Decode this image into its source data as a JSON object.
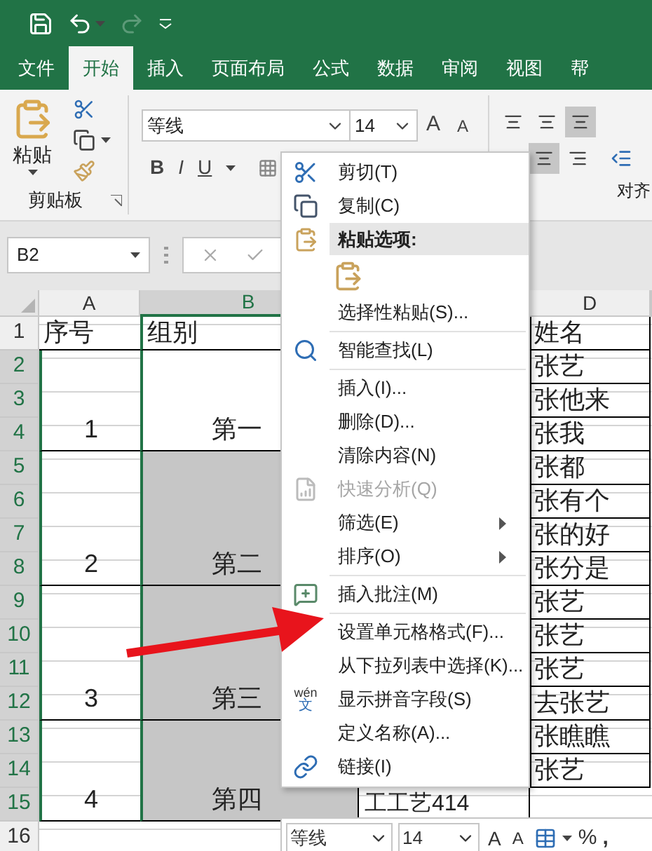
{
  "tabs": [
    {
      "label": "文件",
      "selected": false
    },
    {
      "label": "开始",
      "selected": true
    },
    {
      "label": "插入",
      "selected": false
    },
    {
      "label": "页面布局",
      "selected": false
    },
    {
      "label": "公式",
      "selected": false
    },
    {
      "label": "数据",
      "selected": false
    },
    {
      "label": "审阅",
      "selected": false
    },
    {
      "label": "视图",
      "selected": false
    },
    {
      "label": "帮",
      "selected": false
    }
  ],
  "ribbon": {
    "paste_label": "粘贴",
    "clipboard_group": "剪贴板",
    "font_name": "等线",
    "font_size": "14",
    "grow_font": "A",
    "shrink_font": "A",
    "bold": "B",
    "italic": "I",
    "underline": "U",
    "align_group": "对齐",
    "align_buttons": [
      {
        "selected": false
      },
      {
        "selected": false
      },
      {
        "selected": true
      }
    ],
    "halign_buttons": [
      {
        "selected": true
      },
      {
        "selected": false
      }
    ]
  },
  "formula_bar": {
    "name_box": "B2"
  },
  "sheet": {
    "column_headers": [
      {
        "label": "A",
        "selected": false
      },
      {
        "label": "B",
        "selected": true
      },
      {
        "label": "D",
        "selected": false
      }
    ],
    "row_headers": [
      {
        "label": "1",
        "selected": false
      },
      {
        "label": "2",
        "selected": true
      },
      {
        "label": "3",
        "selected": true
      },
      {
        "label": "4",
        "selected": true
      },
      {
        "label": "5",
        "selected": true
      },
      {
        "label": "6",
        "selected": true
      },
      {
        "label": "7",
        "selected": true
      },
      {
        "label": "8",
        "selected": true
      },
      {
        "label": "9",
        "selected": true
      },
      {
        "label": "10",
        "selected": true
      },
      {
        "label": "11",
        "selected": true
      },
      {
        "label": "12",
        "selected": true
      },
      {
        "label": "13",
        "selected": true
      },
      {
        "label": "14",
        "selected": true
      },
      {
        "label": "15",
        "selected": true
      },
      {
        "label": "16",
        "selected": false
      }
    ],
    "header_row": {
      "number": "序号",
      "group": "组别",
      "name": "姓名"
    },
    "groups": [
      {
        "number": "1",
        "group": "第一",
        "selected": false,
        "rows": [
          {
            "name": "张艺"
          },
          {
            "name": "张他来"
          },
          {
            "name": "张我"
          }
        ]
      },
      {
        "number": "2",
        "group": "第二",
        "selected": true,
        "rows": [
          {
            "name": "张都"
          },
          {
            "name": "张有个"
          },
          {
            "name": "张的好"
          },
          {
            "name": "张分是"
          }
        ]
      },
      {
        "number": "3",
        "group": "第三",
        "selected": true,
        "rows": [
          {
            "name": "张艺"
          },
          {
            "name": "张艺"
          },
          {
            "name": "张艺"
          },
          {
            "name": "去张艺"
          }
        ]
      },
      {
        "number": "4",
        "group": "第四",
        "selected": true,
        "rows": [
          {
            "name": "张瞧瞧"
          },
          {
            "name": "张艺"
          },
          {
            "column_c": "工工艺414"
          }
        ]
      }
    ]
  },
  "context_menu": {
    "items": [
      {
        "kind": "command",
        "label": "剪切(T)"
      },
      {
        "kind": "command",
        "label": "复制(C)"
      },
      {
        "kind": "header",
        "label": "粘贴选项:"
      },
      {
        "kind": "paste_option"
      },
      {
        "kind": "command",
        "label": "选择性粘贴(S)..."
      },
      {
        "kind": "separator"
      },
      {
        "kind": "command",
        "label": "智能查找(L)"
      },
      {
        "kind": "separator"
      },
      {
        "kind": "command",
        "label": "插入(I)..."
      },
      {
        "kind": "command",
        "label": "删除(D)..."
      },
      {
        "kind": "command",
        "label": "清除内容(N)"
      },
      {
        "kind": "command",
        "label": "快速分析(Q)",
        "disabled": true
      },
      {
        "kind": "command",
        "label": "筛选(E)",
        "submenu": true
      },
      {
        "kind": "command",
        "label": "排序(O)",
        "submenu": true
      },
      {
        "kind": "separator"
      },
      {
        "kind": "command",
        "label": "插入批注(M)"
      },
      {
        "kind": "separator"
      },
      {
        "kind": "command",
        "label": "设置单元格格式(F)..."
      },
      {
        "kind": "command",
        "label": "从下拉列表中选择(K)..."
      },
      {
        "kind": "command",
        "label": "显示拼音字段(S)",
        "icon_top": "wén",
        "icon_bottom": "文"
      },
      {
        "kind": "command",
        "label": "定义名称(A)..."
      },
      {
        "kind": "command",
        "label": "链接(I)"
      }
    ]
  },
  "mini_toolbar": {
    "font": "等线",
    "size": "14",
    "grow": "A",
    "shrink": "A",
    "percent": "%",
    "comma": ","
  }
}
